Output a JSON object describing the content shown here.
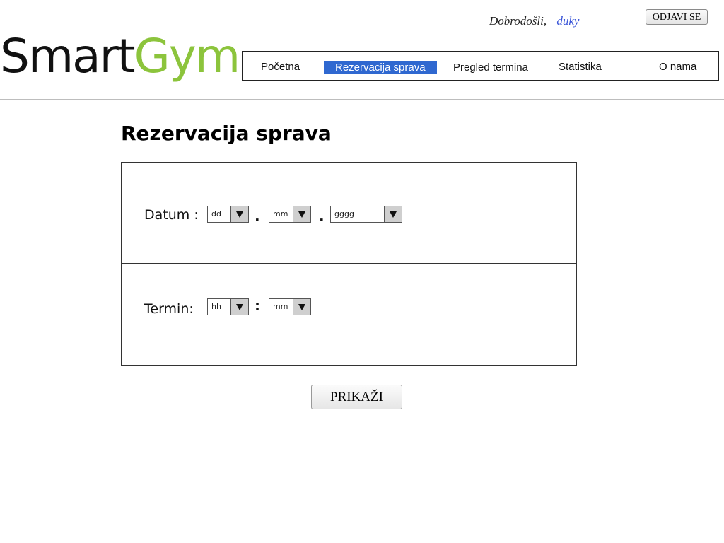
{
  "header": {
    "welcome_text": "Dobrodošli,",
    "username": "duky",
    "logout_label": "ODJAVI SE"
  },
  "logo": {
    "part1": "Smart",
    "part2": "Gym"
  },
  "nav": {
    "items": [
      {
        "label": "Početna"
      },
      {
        "label": "Rezervacija sprava"
      },
      {
        "label": "Pregled termina"
      },
      {
        "label": "Statistika"
      },
      {
        "label": "O nama"
      }
    ],
    "active_index": 1
  },
  "page": {
    "title": "Rezervacija sprava"
  },
  "form": {
    "date": {
      "label": "Datum :",
      "day_value": "dd",
      "month_value": "mm",
      "year_value": "gggg",
      "separator": "."
    },
    "time": {
      "label": "Termin:",
      "hour_value": "hh",
      "minute_value": "mm",
      "separator": ":"
    }
  },
  "show_button_label": "PRIKAŽI",
  "colors": {
    "logo_accent": "#8cc43c",
    "nav_active": "#2f68d0",
    "username": "#3a55d8"
  }
}
